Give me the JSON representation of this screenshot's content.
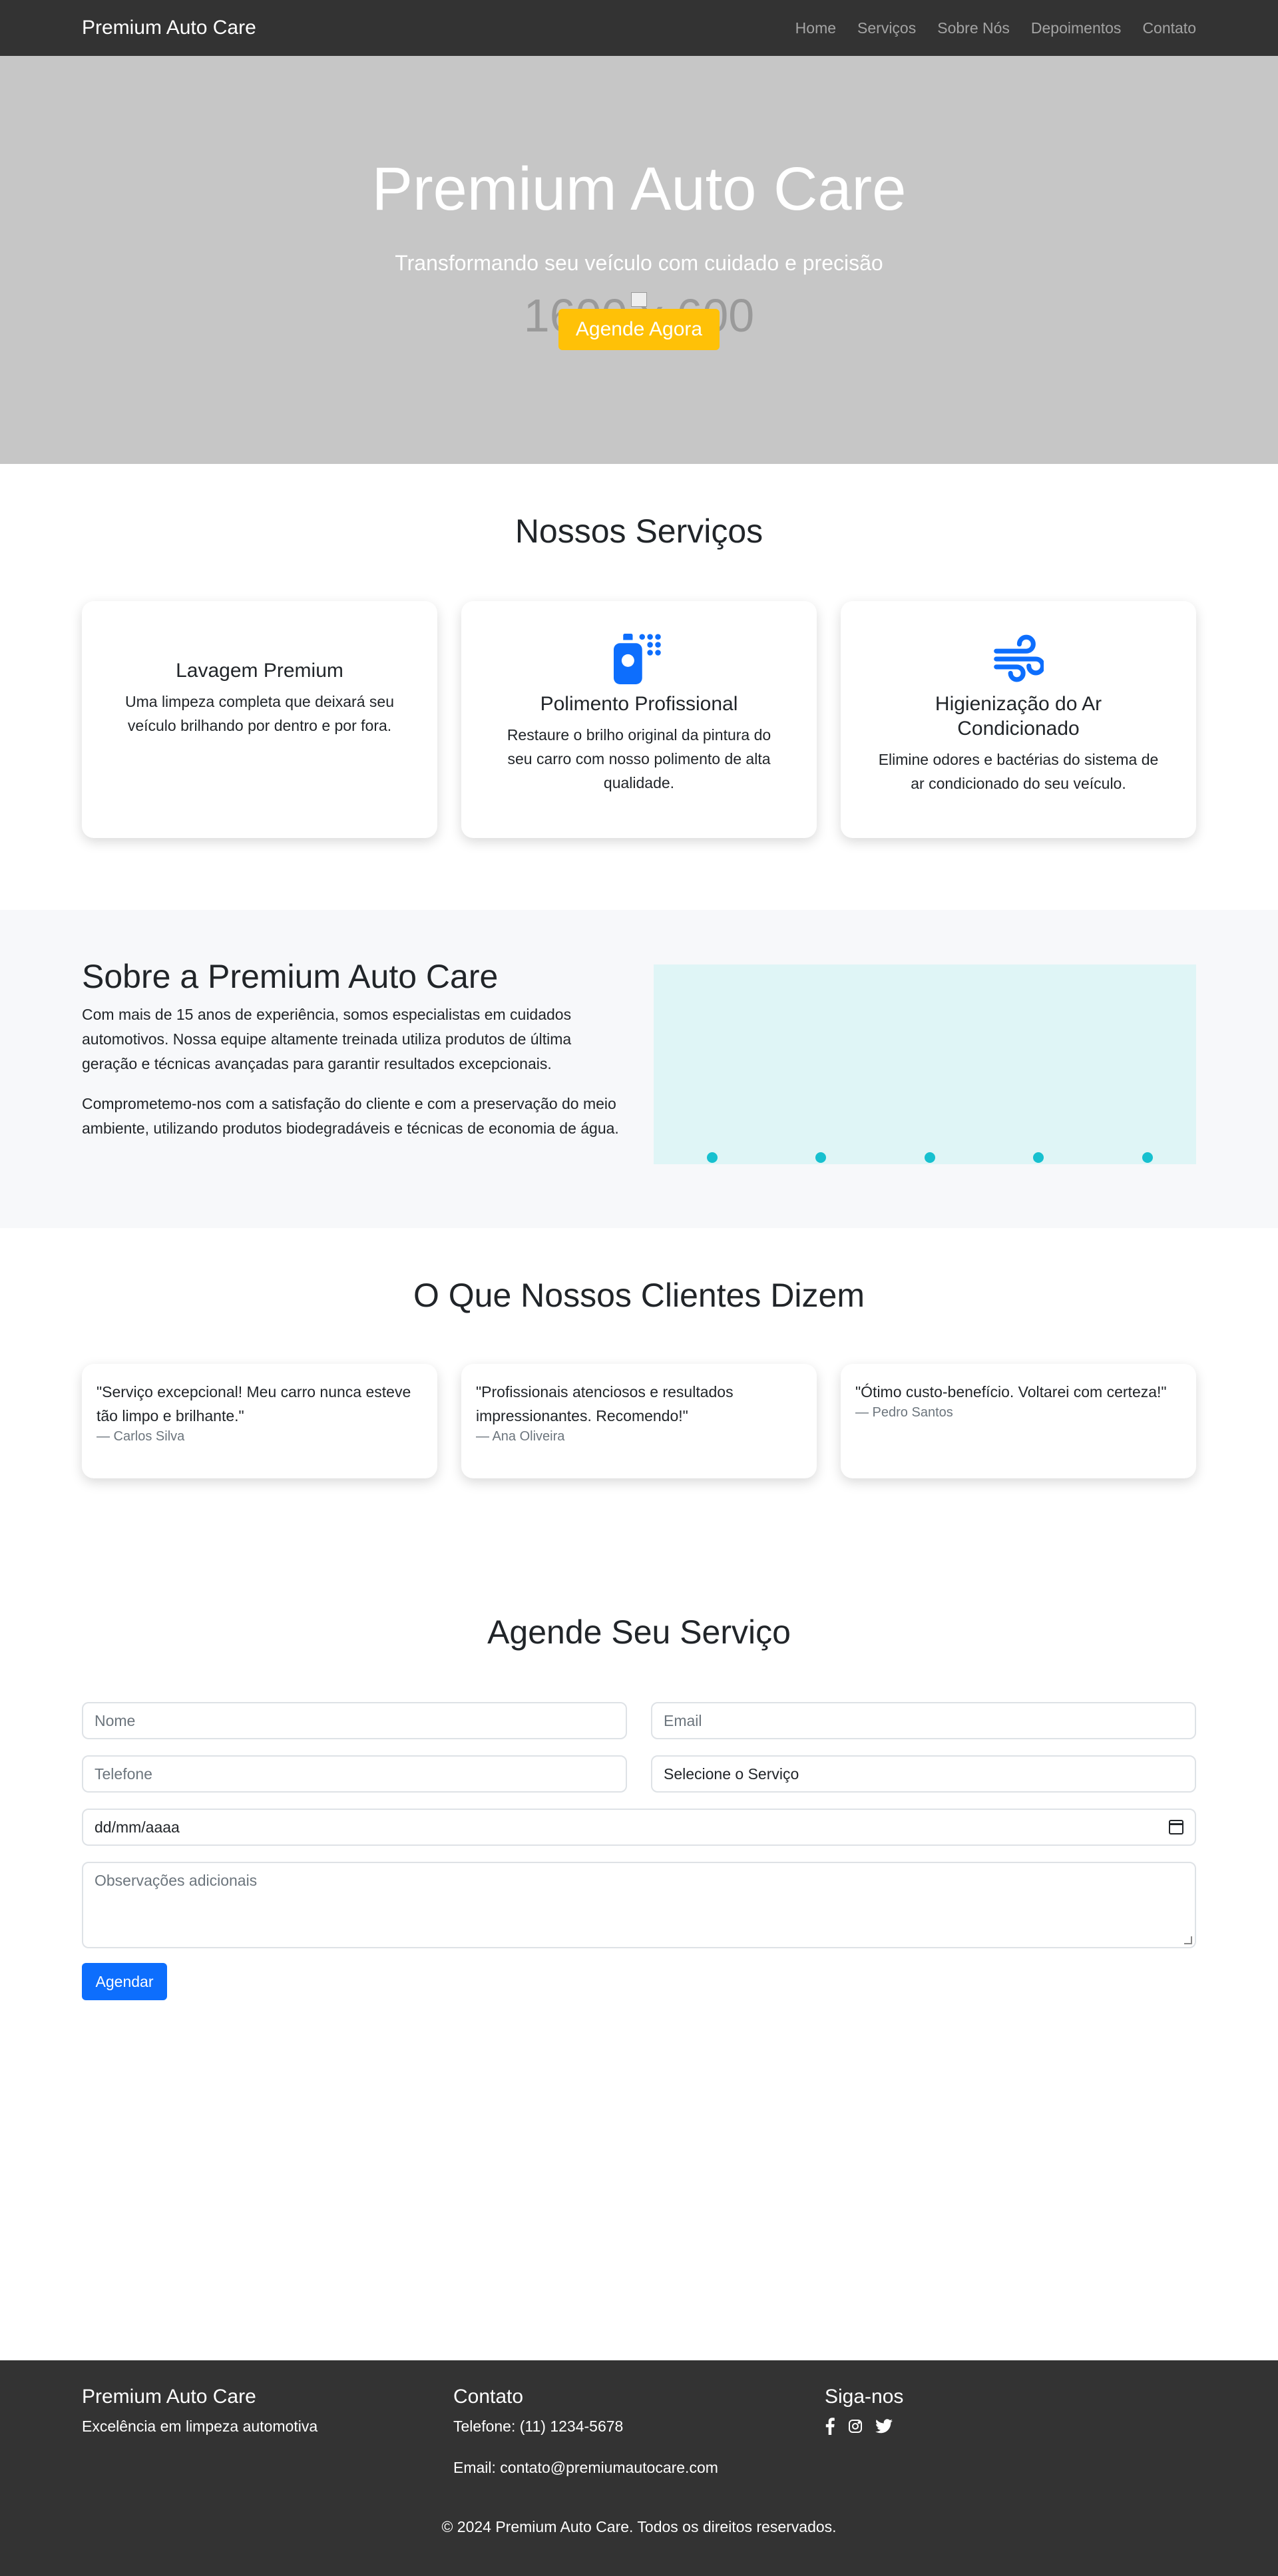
{
  "nav": {
    "brand": "Premium Auto Care",
    "links": [
      "Home",
      "Serviços",
      "Sobre Nós",
      "Depoimentos",
      "Contato"
    ]
  },
  "hero": {
    "placeholder_text": "1600 x 600",
    "title": "Premium Auto Care",
    "subtitle": "Transformando seu veículo com cuidado e precisão",
    "cta_label": "Agende Agora"
  },
  "services": {
    "title": "Nossos Serviços",
    "items": [
      {
        "title": "Lavagem Premium",
        "description": "Uma limpeza completa que deixará seu veículo brilhando por dentro e por fora.",
        "icon": ""
      },
      {
        "title": "Polimento Profissional",
        "description": "Restaure o brilho original da pintura do seu carro com nosso polimento de alta qualidade.",
        "icon": "spray-bottle-icon"
      },
      {
        "title": "Higienização do Ar Condicionado",
        "description": "Elimine odores e bactérias do sistema de ar condicionado do seu veículo.",
        "icon": "wind-icon"
      }
    ],
    "icon_color": "#0d6efd"
  },
  "about": {
    "title": "Sobre a Premium Auto Care",
    "paragraphs": [
      "Com mais de 15 anos de experiência, somos especialistas em cuidados automotivos. Nossa equipe altamente treinada utiliza produtos de última geração e técnicas avançadas para garantir resultados excepcionais.",
      "Comprometemo-nos com a satisfação do cliente e com a preservação do meio ambiente, utilizando produtos biodegradáveis e técnicas de economia de água."
    ],
    "accent": "#17c0cf"
  },
  "testimonials": {
    "title": "O Que Nossos Clientes Dizem",
    "items": [
      {
        "quote": "\"Serviço excepcional! Meu carro nunca esteve tão limpo e brilhante.\"",
        "author": "— Carlos Silva"
      },
      {
        "quote": "\"Profissionais atenciosos e resultados impressionantes. Recomendo!\"",
        "author": "— Ana Oliveira"
      },
      {
        "quote": "\"Ótimo custo-benefício. Voltarei com certeza!\"",
        "author": "— Pedro Santos"
      }
    ]
  },
  "booking": {
    "title": "Agende Seu Serviço",
    "name_placeholder": "Nome",
    "email_placeholder": "Email",
    "phone_placeholder": "Telefone",
    "service_select": "Selecione o Serviço",
    "date_value": "dd/mm/aaaa",
    "notes_placeholder": "Observações adicionais",
    "submit_label": "Agendar"
  },
  "footer": {
    "brand_title": "Premium Auto Care",
    "tagline": "Excelência em limpeza automotiva",
    "contact_title": "Contato",
    "phone": "Telefone: (11) 1234-5678",
    "email": "Email: contato@premiumautocare.com",
    "social_title": "Siga-nos",
    "social_icons": [
      "facebook-icon",
      "instagram-icon",
      "twitter-icon"
    ],
    "copyright": "© 2024 Premium Auto Care. Todos os direitos reservados."
  },
  "colors": {
    "navbar_bg": "#333333",
    "hero_bg": "#c6c6c6",
    "cta": "#ffc107",
    "primary": "#0d6efd"
  }
}
